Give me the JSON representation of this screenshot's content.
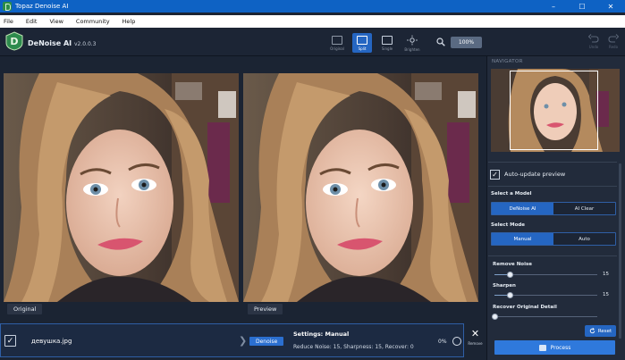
{
  "window": {
    "title": "Topaz Denoise AI",
    "controls": [
      "–",
      "☐",
      "✕"
    ]
  },
  "menu": [
    "File",
    "Edit",
    "View",
    "Community",
    "Help"
  ],
  "app": {
    "name": "DeNoise AI",
    "version": "v2.0.0.3"
  },
  "view_modes": [
    {
      "label": "Original",
      "active": false
    },
    {
      "label": "Split",
      "active": true
    },
    {
      "label": "Single",
      "active": false
    },
    {
      "label": "Brighten",
      "active": false
    }
  ],
  "zoom": "100%",
  "history": {
    "undo": "Undo",
    "redo": "Redo"
  },
  "preview": {
    "left_label": "Original",
    "right_label": "Preview"
  },
  "file": {
    "name": "девушка.jpg",
    "tag": "Denoise",
    "settings_title": "Settings: Manual",
    "settings_detail": "Reduce Noise: 15, Sharpness: 15, Recover: 0",
    "progress": "0%",
    "remove_label": "Remove"
  },
  "navigator": {
    "title": "NAVIGATOR"
  },
  "panel": {
    "auto_update": "Auto-update preview",
    "model_label": "Select a Model",
    "models": [
      {
        "label": "DeNoise AI",
        "active": true
      },
      {
        "label": "AI Clear",
        "active": false
      }
    ],
    "mode_label": "Select Mode",
    "modes": [
      {
        "label": "Manual",
        "active": true
      },
      {
        "label": "Auto",
        "active": false
      }
    ],
    "sliders": [
      {
        "label": "Remove Noise",
        "value": "15",
        "fraction": 0.15
      },
      {
        "label": "Sharpen",
        "value": "15",
        "fraction": 0.15
      },
      {
        "label": "Recover Original Detail",
        "value": "",
        "fraction": 0.0
      }
    ],
    "reset": "Reset",
    "process": "Process"
  },
  "colors": {
    "accent": "#2566c2",
    "titlebar": "#0e62c4",
    "background": "#1b2433"
  }
}
